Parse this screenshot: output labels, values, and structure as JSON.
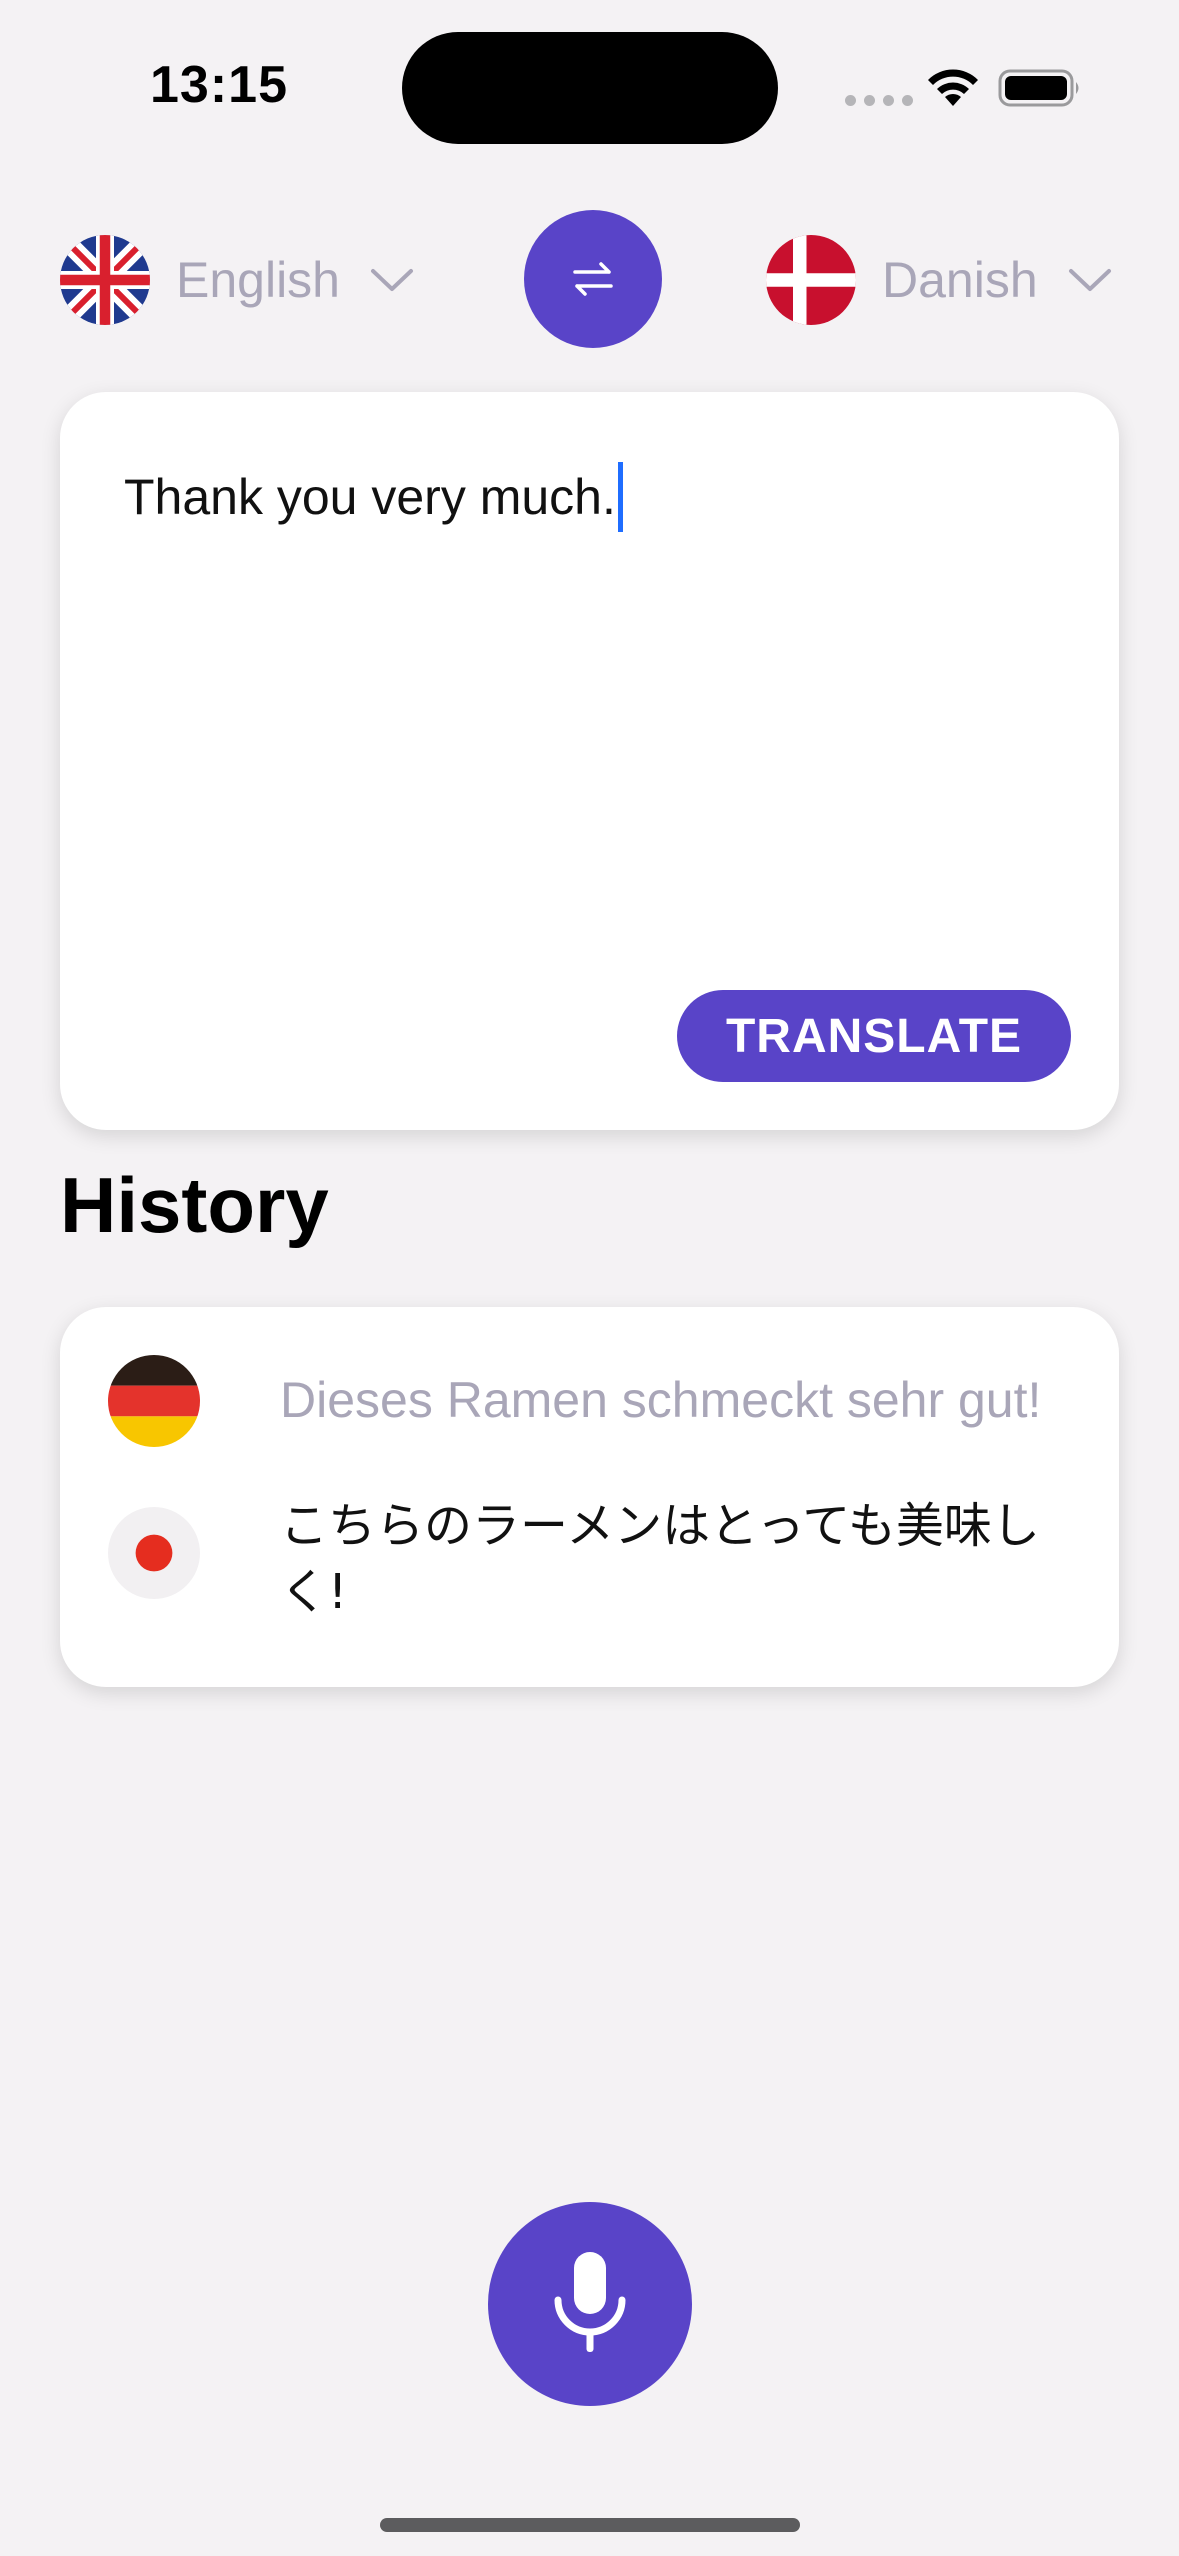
{
  "status_bar": {
    "time": "13:15"
  },
  "languages": {
    "source": {
      "name": "English",
      "flag_icon": "uk-flag-icon"
    },
    "target": {
      "name": "Danish",
      "flag_icon": "denmark-flag-icon"
    }
  },
  "input": {
    "text": "Thank you very much."
  },
  "actions": {
    "translate_label": "TRANSLATE"
  },
  "history": {
    "title": "History",
    "items": [
      {
        "flag_icon": "germany-flag-icon",
        "text": "Dieses Ramen schmeckt sehr gut!"
      },
      {
        "flag_icon": "japan-flag-icon",
        "text": "こちらのラーメンはとっても美味しく!"
      }
    ]
  },
  "colors": {
    "accent": "#5944c8",
    "background": "#f4f2f4",
    "muted_text": "#a9a6b8",
    "caret": "#1f6dff"
  }
}
